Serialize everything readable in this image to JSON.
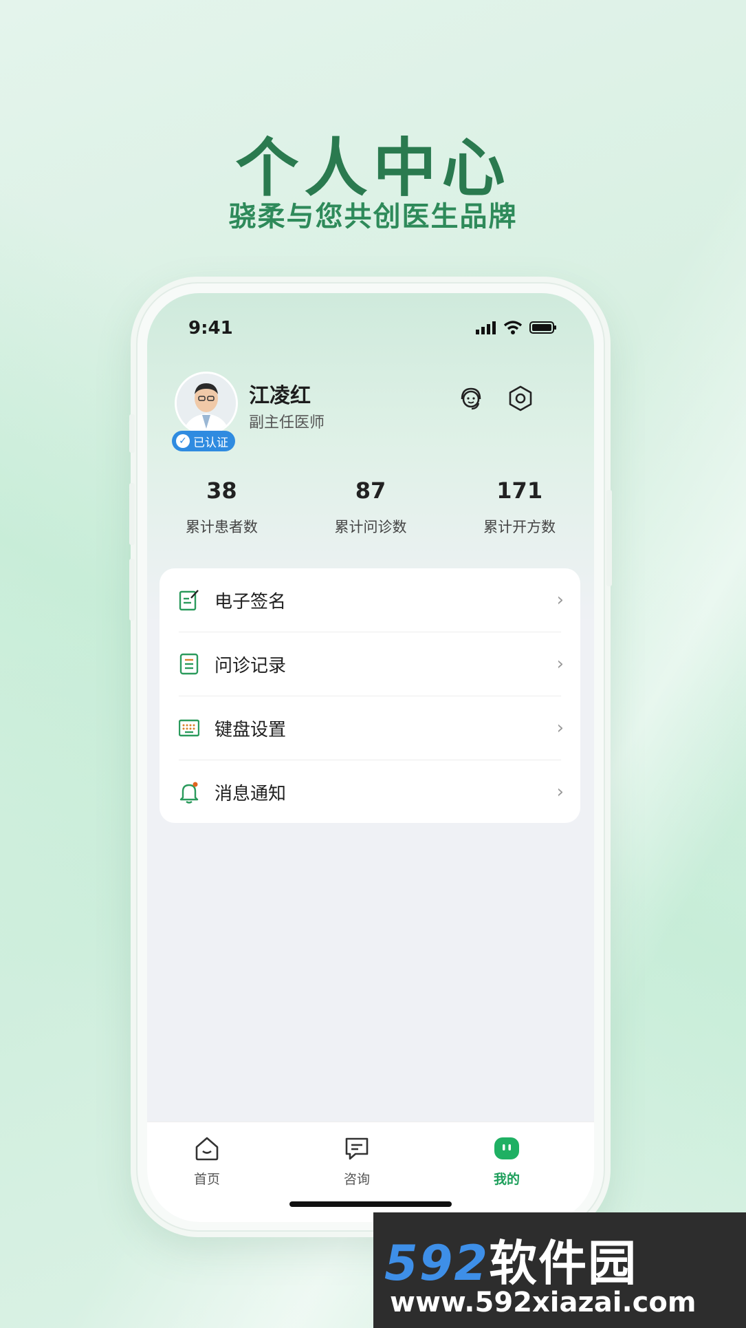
{
  "promo": {
    "title": "个人中心",
    "subtitle": "骁柔与您共创医生品牌"
  },
  "status_bar": {
    "time": "9:41"
  },
  "profile": {
    "name": "江凌红",
    "title": "副主任医师",
    "verified_label": "已认证"
  },
  "stats": [
    {
      "value": "38",
      "label": "累计患者数"
    },
    {
      "value": "87",
      "label": "累计问诊数"
    },
    {
      "value": "171",
      "label": "累计开方数"
    }
  ],
  "menu": [
    {
      "label": "电子签名",
      "icon": "signature-icon"
    },
    {
      "label": "问诊记录",
      "icon": "record-icon"
    },
    {
      "label": "键盘设置",
      "icon": "keyboard-icon"
    },
    {
      "label": "消息通知",
      "icon": "bell-icon"
    }
  ],
  "tabbar": [
    {
      "label": "首页",
      "icon": "home-icon",
      "active": false
    },
    {
      "label": "咨询",
      "icon": "chat-icon",
      "active": false
    },
    {
      "label": "我的",
      "icon": "profile-tab-icon",
      "active": true
    }
  ],
  "colors": {
    "brand_green": "#2a7a4f",
    "accent_green": "#1c9e5a",
    "verified_blue": "#2f8be0"
  },
  "watermark": {
    "brand_num": "592",
    "brand_cn": "软件园",
    "url": "www.592xiazai.com"
  }
}
